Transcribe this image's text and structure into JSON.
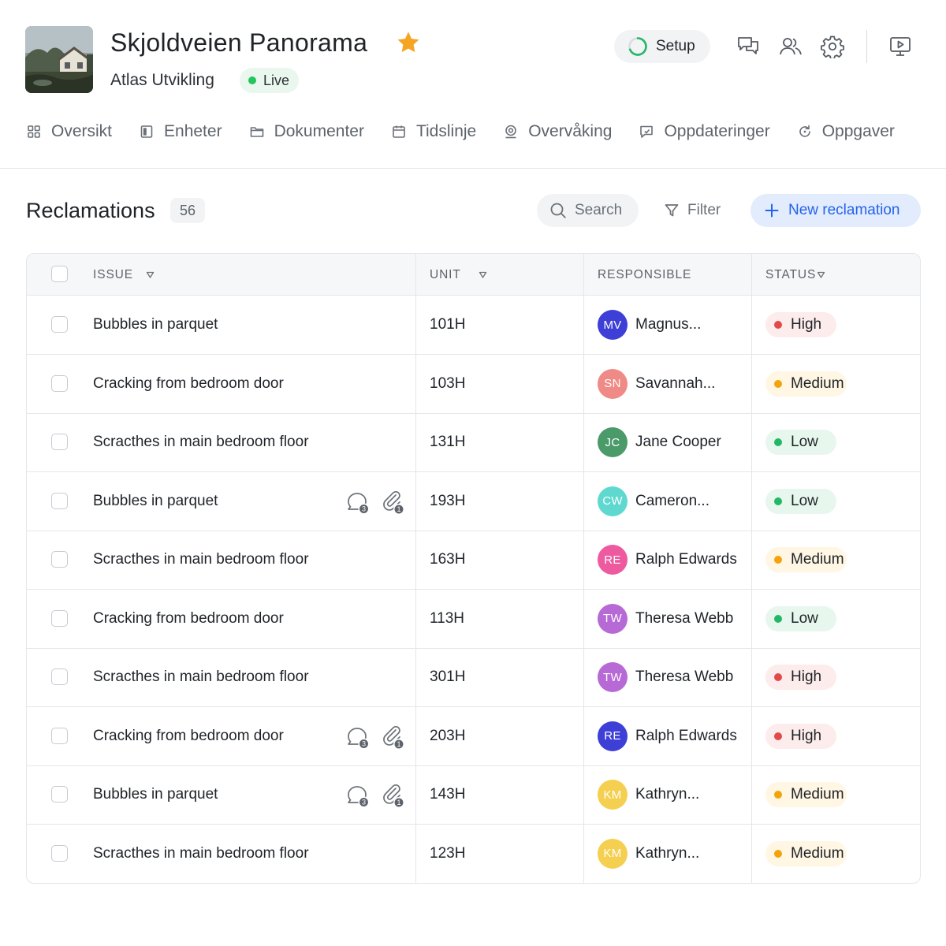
{
  "project": {
    "title": "Skjoldveien Panorama",
    "company": "Atlas Utvikling",
    "status": "Live",
    "favorite": true
  },
  "header_actions": {
    "setup_label": "Setup",
    "icons": [
      "chat-icon",
      "users-icon",
      "gear-icon",
      "presentation-icon"
    ]
  },
  "nav": {
    "tabs": [
      {
        "label": "Oversikt",
        "icon": "grid-icon"
      },
      {
        "label": "Enheter",
        "icon": "units-icon"
      },
      {
        "label": "Dokumenter",
        "icon": "folder-icon"
      },
      {
        "label": "Tidslinje",
        "icon": "calendar-icon"
      },
      {
        "label": "Overvåking",
        "icon": "camera-icon"
      },
      {
        "label": "Oppdateringer",
        "icon": "message-icon"
      },
      {
        "label": "Oppgaver",
        "icon": "refresh-icon"
      }
    ]
  },
  "list": {
    "title": "Reclamations",
    "count": "56",
    "search_label": "Search",
    "filter_label": "Filter",
    "new_button_label": "New reclamation"
  },
  "table": {
    "columns": {
      "issue": "ISSUE",
      "unit": "UNIT",
      "responsible": "RESPONSIBLE",
      "status": "STATUS"
    },
    "rows": [
      {
        "issue": "Bubbles in parquet",
        "unit": "101H",
        "initials": "MV",
        "name": "Magnus...",
        "avatar_color": "#3d3fd6",
        "status": "High",
        "comments": "",
        "attachments": ""
      },
      {
        "issue": "Cracking from bedroom door",
        "unit": "103H",
        "initials": "SN",
        "name": "Savannah...",
        "avatar_color": "#f08a86",
        "status": "Medium",
        "comments": "",
        "attachments": ""
      },
      {
        "issue": "Scracthes in main bedroom floor",
        "unit": "131H",
        "initials": "JC",
        "name": "Jane Cooper",
        "avatar_color": "#4a9a6a",
        "status": "Low",
        "comments": "",
        "attachments": ""
      },
      {
        "issue": "Bubbles in parquet",
        "unit": "193H",
        "initials": "CW",
        "name": "Cameron...",
        "avatar_color": "#5fd9d0",
        "status": "Low",
        "comments": "3",
        "attachments": "1"
      },
      {
        "issue": "Scracthes in main bedroom floor",
        "unit": "163H",
        "initials": "RE",
        "name": "Ralph Edwards",
        "avatar_color": "#ee5aa0",
        "status": "Medium",
        "comments": "",
        "attachments": ""
      },
      {
        "issue": "Cracking from bedroom door",
        "unit": "113H",
        "initials": "TW",
        "name": "Theresa Webb",
        "avatar_color": "#b76ad6",
        "status": "Low",
        "comments": "",
        "attachments": ""
      },
      {
        "issue": "Scracthes in main bedroom floor",
        "unit": "301H",
        "initials": "TW",
        "name": "Theresa Webb",
        "avatar_color": "#b76ad6",
        "status": "High",
        "comments": "",
        "attachments": ""
      },
      {
        "issue": "Cracking from bedroom door",
        "unit": "203H",
        "initials": "RE",
        "name": "Ralph Edwards",
        "avatar_color": "#3d3fd6",
        "status": "High",
        "comments": "3",
        "attachments": "1"
      },
      {
        "issue": "Bubbles in parquet",
        "unit": "143H",
        "initials": "KM",
        "name": "Kathryn...",
        "avatar_color": "#f5cf4f",
        "status": "Medium",
        "comments": "3",
        "attachments": "1"
      },
      {
        "issue": "Scracthes in main bedroom floor",
        "unit": "123H",
        "initials": "KM",
        "name": "Kathryn...",
        "avatar_color": "#f5cf4f",
        "status": "Medium",
        "comments": "",
        "attachments": ""
      }
    ]
  },
  "colors": {
    "accent": "#2563eb",
    "live": "#22c55e",
    "status": {
      "High": {
        "dot": "#e24a4a",
        "bg": "#fdecec"
      },
      "Medium": {
        "dot": "#f5a30a",
        "bg": "#fff6e4"
      },
      "Low": {
        "dot": "#22b866",
        "bg": "#e8f7ee"
      }
    }
  }
}
